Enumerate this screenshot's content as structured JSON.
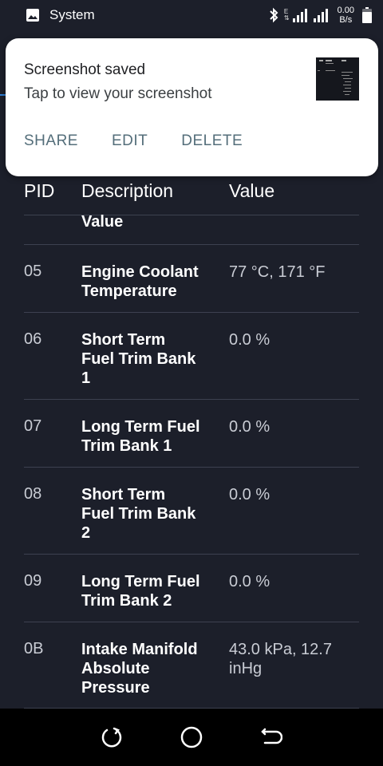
{
  "status_bar": {
    "app_label": "System",
    "network_type": "E",
    "speed_value": "0.00",
    "speed_unit": "B/s"
  },
  "notification": {
    "title": "Screenshot saved",
    "subtitle": "Tap to view your screenshot",
    "actions": [
      "SHARE",
      "EDIT",
      "DELETE"
    ]
  },
  "table": {
    "headers": {
      "pid": "PID",
      "description": "Description",
      "value": "Value"
    },
    "partial_row": {
      "description": "Value"
    },
    "rows": [
      {
        "pid": "05",
        "description": "Engine Coolant Temperature",
        "value": "77 °C, 171 °F"
      },
      {
        "pid": "06",
        "description": "Short Term Fuel Trim Bank 1",
        "value": "0.0 %"
      },
      {
        "pid": "07",
        "description": "Long Term Fuel Trim Bank 1",
        "value": "0.0 %"
      },
      {
        "pid": "08",
        "description": "Short Term Fuel Trim Bank 2",
        "value": "0.0 %"
      },
      {
        "pid": "09",
        "description": "Long Term Fuel Trim Bank 2",
        "value": "0.0 %"
      },
      {
        "pid": "0B",
        "description": "Intake Manifold Absolute Pressure",
        "value": "43.0 kPa, 12.7 inHg"
      }
    ]
  },
  "colors": {
    "background": "#1c1f2a",
    "divider": "#3d4150",
    "action_text": "#546e7a"
  },
  "nav_bar": {
    "icons": [
      "recent-apps-icon",
      "home-icon",
      "back-icon"
    ]
  }
}
